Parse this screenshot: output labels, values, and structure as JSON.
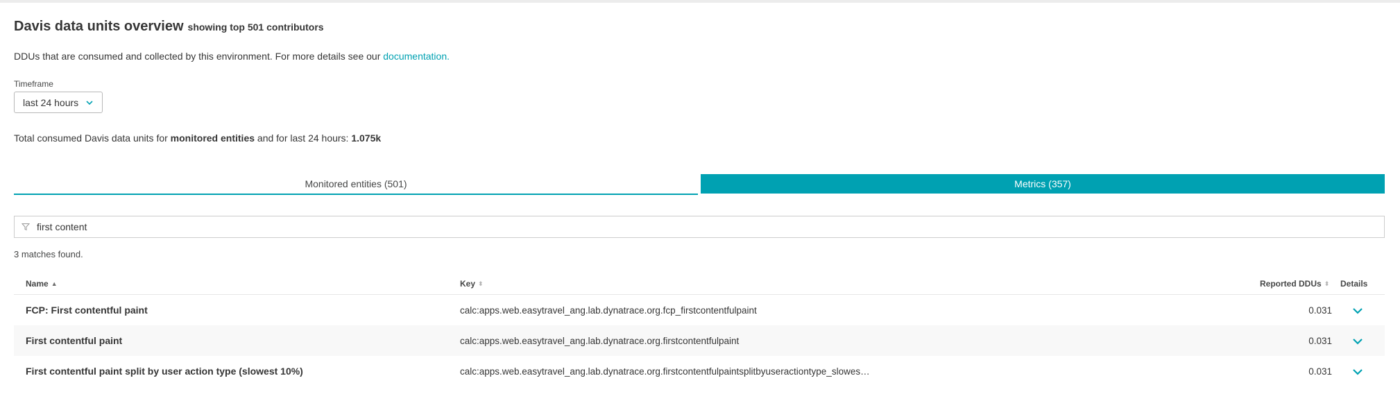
{
  "header": {
    "title": "Davis data units overview",
    "subtitle": "showing top 501 contributors"
  },
  "description": {
    "text": "DDUs that are consumed and collected by this environment. For more details see our ",
    "link": "documentation."
  },
  "timeframe": {
    "label": "Timeframe",
    "value": "last 24 hours"
  },
  "total": {
    "prefix": "Total consumed Davis data units for ",
    "scope": "monitored entities",
    "middle": " and for last 24 hours: ",
    "value": "1.075k"
  },
  "tabs": [
    {
      "label": "Monitored entities (501)",
      "active": false
    },
    {
      "label": "Metrics (357)",
      "active": true
    }
  ],
  "filter": {
    "value": "first content",
    "icon": "filter-icon"
  },
  "matches": "3 matches found.",
  "table": {
    "columns": {
      "name": "Name",
      "key": "Key",
      "ddus": "Reported DDUs",
      "details": "Details"
    },
    "rows": [
      {
        "name": "FCP: First contentful paint",
        "key": "calc:apps.web.easytravel_ang.lab.dynatrace.org.fcp_firstcontentfulpaint",
        "ddus": "0.031"
      },
      {
        "name": "First contentful paint",
        "key": "calc:apps.web.easytravel_ang.lab.dynatrace.org.firstcontentfulpaint",
        "ddus": "0.031"
      },
      {
        "name": "First contentful paint split by user action type (slowest 10%)",
        "key": "calc:apps.web.easytravel_ang.lab.dynatrace.org.firstcontentfulpaintsplitbyuseractiontype_slowes…",
        "ddus": "0.031"
      }
    ]
  },
  "colors": {
    "accent": "#00a1b2",
    "text": "#353535"
  }
}
